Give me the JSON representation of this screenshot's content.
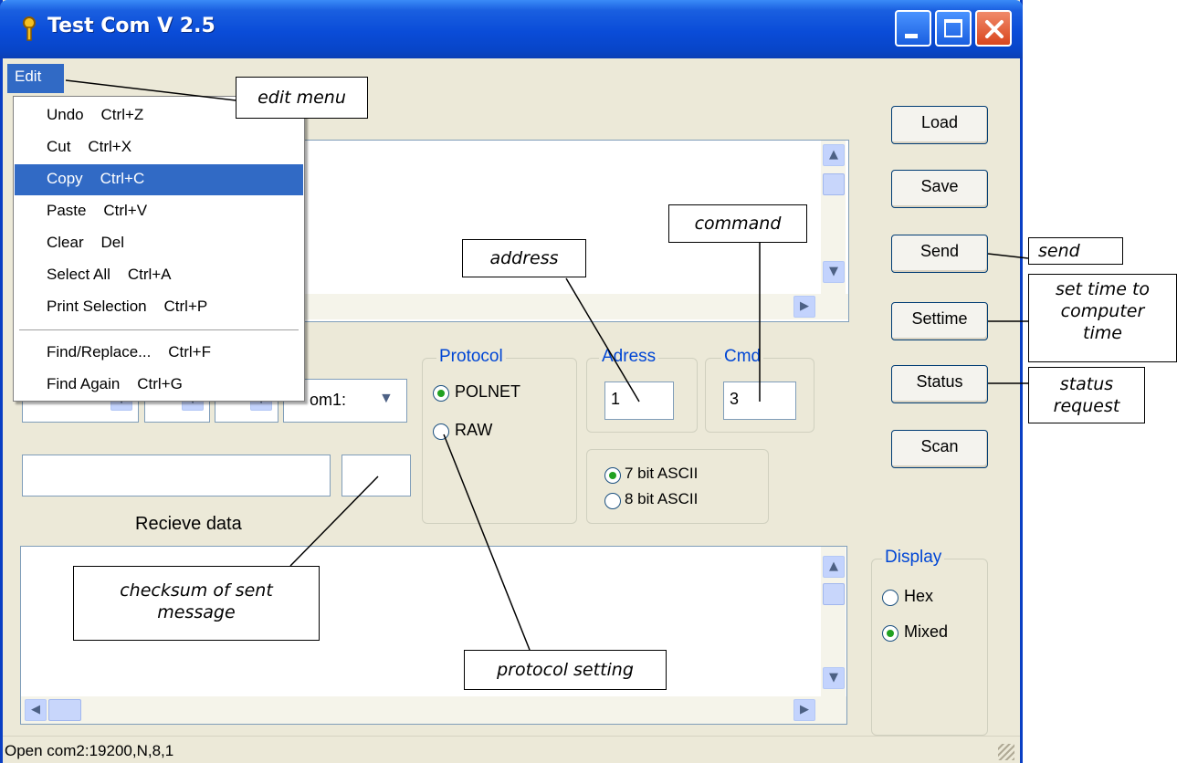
{
  "window": {
    "title": "Test Com V 2.5"
  },
  "menubar": {
    "edit_label": "Edit"
  },
  "edit_menu": {
    "items": [
      "Undo    Ctrl+Z",
      "Cut    Ctrl+X",
      "Copy    Ctrl+C",
      "Paste    Ctrl+V",
      "Clear    Del",
      "Select All    Ctrl+A",
      "Print Selection    Ctrl+P",
      "Find/Replace...    Ctrl+F",
      "Find Again    Ctrl+G"
    ],
    "selected": "Copy    Ctrl+C"
  },
  "buttons": {
    "load": "Load",
    "save": "Save",
    "send": "Send",
    "settime": "Settime",
    "status": "Status",
    "scan": "Scan"
  },
  "port": {
    "selected": "om1:"
  },
  "protocol": {
    "label": "Protocol",
    "options": [
      "POLNET",
      "RAW"
    ],
    "selected": "POLNET"
  },
  "address": {
    "label": "Adress",
    "value": "1"
  },
  "cmd": {
    "label": "Cmd",
    "value": "3"
  },
  "ascii": {
    "options": [
      "7 bit ASCII",
      "8 bit ASCII"
    ],
    "selected": "7 bit ASCII"
  },
  "receive": {
    "label": "Recieve data"
  },
  "display": {
    "label": "Display",
    "options": [
      "Hex",
      "Mixed"
    ],
    "selected": "Mixed"
  },
  "statusbar": {
    "text": "Open com2:19200,N,8,1"
  },
  "annotations": {
    "edit_menu": "edit menu",
    "address": "address",
    "command": "command",
    "send": "send",
    "settime": [
      "set time to",
      "computer",
      "time"
    ],
    "status": [
      "status",
      "request"
    ],
    "checksum": [
      "checksum of sent",
      "message"
    ],
    "protocol": "protocol setting"
  },
  "colors": {
    "title_blue": "#0a4cd8",
    "menu_highlight": "#316ac5",
    "group_label": "#0046d5"
  }
}
